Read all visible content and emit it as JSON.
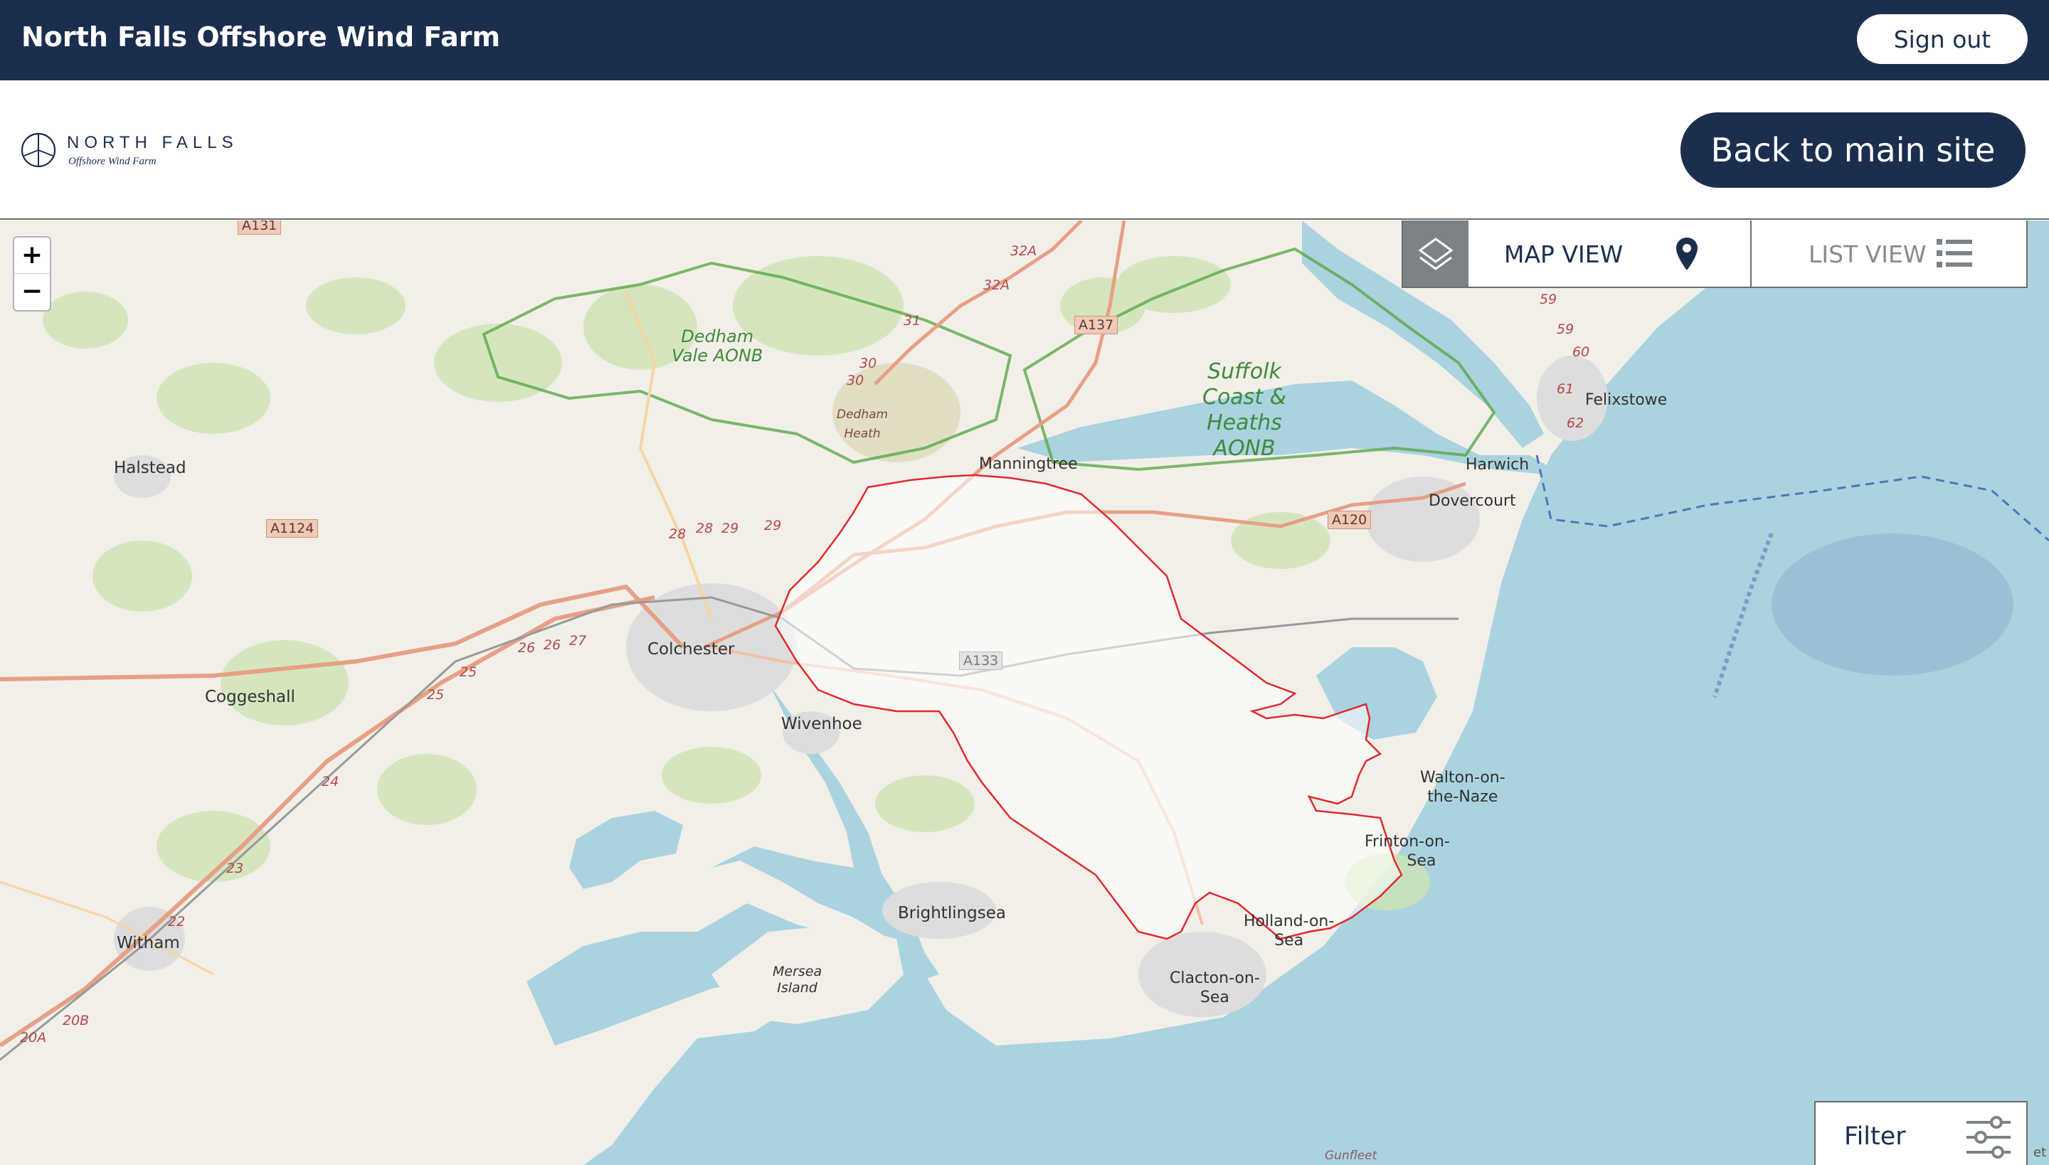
{
  "app": {
    "title": "North Falls Offshore Wind Farm",
    "sign_out_label": "Sign out"
  },
  "header": {
    "logo_wordmark": "NORTH FALLS",
    "logo_tagline": "Offshore Wind Farm",
    "back_label": "Back to main site"
  },
  "map": {
    "zoom_in": "+",
    "zoom_out": "−",
    "view_toggle": {
      "map_label": "MAP VIEW",
      "list_label": "LIST VIEW",
      "active": "map"
    },
    "filter_label": "Filter",
    "attribution": "et",
    "colors": {
      "sea": "#aad3df",
      "land": "#f2efe9",
      "boundary": "#e2292e",
      "aonb": "#5aa84a",
      "primary_road": "#e38a6f"
    },
    "places": {
      "halstead": "Halstead",
      "coggeshall": "Coggeshall",
      "witham": "Witham",
      "colchester": "Colchester",
      "wivenhoe": "Wivenhoe",
      "manningtree": "Manningtree",
      "harwich": "Harwich",
      "dovercourt": "Dovercourt",
      "felixstowe": "Felixstowe",
      "walton_1": "Walton-on-",
      "walton_2": "the-Naze",
      "frinton_1": "Frinton-on-",
      "frinton_2": "Sea",
      "holland_1": "Holland-on-",
      "holland_2": "Sea",
      "clacton_1": "Clacton-on-",
      "clacton_2": "Sea",
      "brightlingsea": "Brightlingsea",
      "mersea_1": "Mersea",
      "mersea_2": "Island",
      "dedham_heath_1": "Dedham",
      "dedham_heath_2": "Heath",
      "gunfleet": "Gunfleet"
    },
    "aonb": {
      "dedham_1": "Dedham",
      "dedham_2": "Vale AONB",
      "suffolk_1": "Suffolk",
      "suffolk_2": "Coast &",
      "suffolk_3": "Heaths",
      "suffolk_4": "AONB"
    },
    "roads": {
      "a131": "A131",
      "a1124": "A1124",
      "a137": "A137",
      "a120": "A120",
      "a133": "A133"
    },
    "junctions": {
      "j20a": "20A",
      "j20b": "20B",
      "j22": "22",
      "j23": "23",
      "j24": "24",
      "j25a": "25",
      "j25b": "25",
      "j26a": "26",
      "j26b": "26",
      "j27": "27",
      "j28a": "28",
      "j28b": "28",
      "j29a": "29",
      "j29b": "29",
      "j30a": "30",
      "j30b": "30",
      "j31": "31",
      "j32a": "32A",
      "j32b": "32A",
      "j59a": "59",
      "j59b": "59",
      "j60": "60",
      "j61": "61",
      "j62": "62"
    }
  }
}
